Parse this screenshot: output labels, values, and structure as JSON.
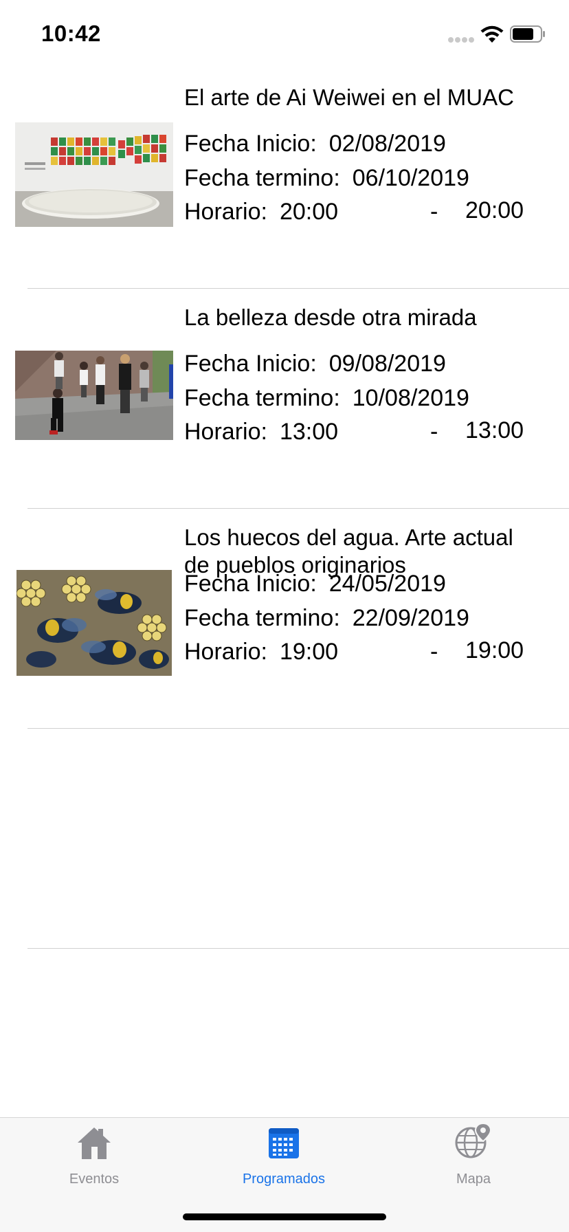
{
  "status_bar": {
    "time": "10:42"
  },
  "events": [
    {
      "title": "El arte de Ai Weiwei en el MUAC",
      "fecha_inicio_label": "Fecha Inicio:",
      "fecha_inicio": "02/08/2019",
      "fecha_termino_label": "Fecha termino:",
      "fecha_termino": "06/10/2019",
      "horario_label": "Horario:",
      "hora_inicio": "20:00",
      "separator": "-",
      "hora_fin": "20:00"
    },
    {
      "title": "La belleza desde otra mirada",
      "fecha_inicio_label": "Fecha Inicio:",
      "fecha_inicio": "09/08/2019",
      "fecha_termino_label": "Fecha termino:",
      "fecha_termino": "10/08/2019",
      "horario_label": "Horario:",
      "hora_inicio": "13:00",
      "separator": "-",
      "hora_fin": "13:00"
    },
    {
      "title": "Los huecos del agua. Arte actual de pueblos originarios",
      "fecha_inicio_label": "Fecha Inicio:",
      "fecha_inicio": "24/05/2019",
      "fecha_termino_label": "Fecha termino:",
      "fecha_termino": "22/09/2019",
      "horario_label": "Horario:",
      "hora_inicio": "19:00",
      "separator": "-",
      "hora_fin": "19:00"
    }
  ],
  "tab_bar": {
    "active_color": "#1a73e8",
    "inactive_color": "#8e8e93",
    "tabs": [
      {
        "label": "Eventos",
        "icon": "house-icon",
        "active": false
      },
      {
        "label": "Programados",
        "icon": "calendar-icon",
        "active": true
      },
      {
        "label": "Mapa",
        "icon": "globe-pin-icon",
        "active": false
      }
    ]
  }
}
